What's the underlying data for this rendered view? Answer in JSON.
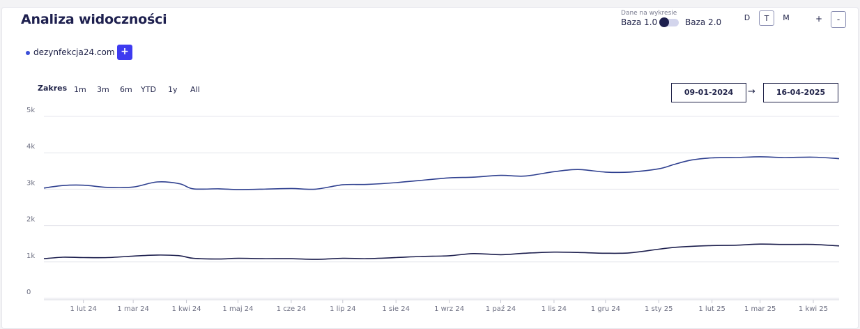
{
  "header": {
    "title": "Analiza widoczności",
    "data_on_chart_label": "Dane na wykresie",
    "baza1": "Baza 1.0",
    "baza2": "Baza 2.0",
    "period_buttons": [
      "D",
      "T",
      "M"
    ],
    "active_period": "T",
    "zoom_in": "+",
    "zoom_out": "-"
  },
  "legend": {
    "domain": "dezynfekcja24.com",
    "add_label": "+",
    "dot_color": "#3b4fd8"
  },
  "range": {
    "label": "Zakres",
    "buttons": [
      "1m",
      "3m",
      "6m",
      "YTD",
      "1y",
      "All"
    ],
    "from": "09-01-2024",
    "arrow": "→",
    "to": "16-04-2025"
  },
  "chart_data": {
    "type": "line",
    "title": "",
    "xlabel": "",
    "ylabel": "",
    "ylim": [
      0,
      5000
    ],
    "yticks": [
      "0",
      "1k",
      "2k",
      "3k",
      "4k",
      "5k"
    ],
    "grid": true,
    "x_tick_labels": [
      "1 lut 24",
      "1 mar 24",
      "1 kwi 24",
      "1 maj 24",
      "1 cze 24",
      "1 lip 24",
      "1 sie 24",
      "1 wrz 24",
      "1 paź 24",
      "1 lis 24",
      "1 gru 24",
      "1 sty 25",
      "1 lut 25",
      "1 mar 25",
      "1 kwi 25"
    ],
    "x_tick_dates": [
      "2024-02-01",
      "2024-03-01",
      "2024-04-01",
      "2024-05-01",
      "2024-06-01",
      "2024-07-01",
      "2024-08-01",
      "2024-09-01",
      "2024-10-01",
      "2024-11-01",
      "2024-12-01",
      "2025-01-01",
      "2025-02-01",
      "2025-03-01",
      "2025-04-01"
    ],
    "x_range": [
      "2024-01-09",
      "2025-04-16"
    ],
    "series": [
      {
        "color": "#2e3f8f",
        "x": [
          "2024-01-09",
          "2024-01-20",
          "2024-02-01",
          "2024-02-15",
          "2024-03-01",
          "2024-03-15",
          "2024-03-28",
          "2024-04-05",
          "2024-04-20",
          "2024-05-01",
          "2024-05-15",
          "2024-06-01",
          "2024-06-15",
          "2024-07-01",
          "2024-07-15",
          "2024-08-01",
          "2024-08-15",
          "2024-09-01",
          "2024-09-15",
          "2024-10-01",
          "2024-10-15",
          "2024-11-01",
          "2024-11-15",
          "2024-12-01",
          "2024-12-15",
          "2025-01-01",
          "2025-01-10",
          "2025-01-20",
          "2025-02-01",
          "2025-02-15",
          "2025-03-01",
          "2025-03-15",
          "2025-04-01",
          "2025-04-16"
        ],
        "values": [
          3030,
          3100,
          3110,
          3050,
          3060,
          3200,
          3150,
          3010,
          3010,
          2990,
          3000,
          3020,
          3000,
          3120,
          3130,
          3180,
          3240,
          3310,
          3330,
          3380,
          3360,
          3480,
          3540,
          3470,
          3470,
          3560,
          3680,
          3800,
          3860,
          3870,
          3890,
          3870,
          3880,
          3840
        ]
      },
      {
        "color": "#1d1f4e",
        "x": [
          "2024-01-09",
          "2024-01-20",
          "2024-02-01",
          "2024-02-15",
          "2024-03-01",
          "2024-03-15",
          "2024-03-28",
          "2024-04-05",
          "2024-04-20",
          "2024-05-01",
          "2024-05-15",
          "2024-06-01",
          "2024-06-15",
          "2024-07-01",
          "2024-07-15",
          "2024-08-01",
          "2024-08-15",
          "2024-09-01",
          "2024-09-15",
          "2024-10-01",
          "2024-10-15",
          "2024-11-01",
          "2024-11-15",
          "2024-12-01",
          "2024-12-15",
          "2025-01-01",
          "2025-01-10",
          "2025-01-20",
          "2025-02-01",
          "2025-02-15",
          "2025-03-01",
          "2025-03-15",
          "2025-04-01",
          "2025-04-16"
        ],
        "values": [
          1090,
          1130,
          1120,
          1120,
          1160,
          1190,
          1170,
          1100,
          1080,
          1100,
          1090,
          1090,
          1070,
          1100,
          1090,
          1120,
          1150,
          1170,
          1230,
          1200,
          1240,
          1270,
          1260,
          1240,
          1250,
          1350,
          1400,
          1430,
          1450,
          1460,
          1490,
          1480,
          1480,
          1440
        ]
      }
    ]
  },
  "colors": {
    "accent": "#3e3bf0",
    "grid": "#e4e5ec",
    "axis_text": "#6d6f82"
  }
}
